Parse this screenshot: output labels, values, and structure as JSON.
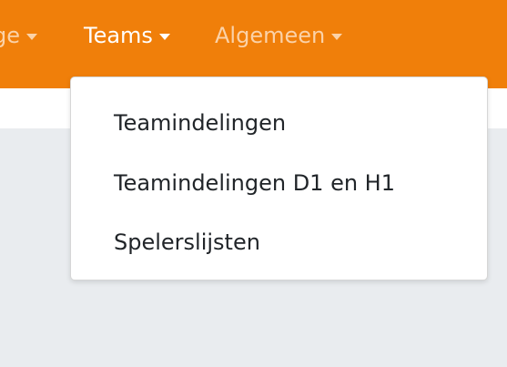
{
  "navbar": {
    "background_color": "#f07f0a",
    "items": [
      {
        "label": "ge",
        "state": "partially-visible",
        "icon": "caret-down-icon"
      },
      {
        "label": "Teams",
        "state": "open",
        "icon": "caret-down-icon"
      },
      {
        "label": "Algemeen",
        "icon": "caret-down-icon"
      }
    ]
  },
  "dropdown": {
    "items": [
      {
        "label": "Teamindelingen"
      },
      {
        "label": "Teamindelingen D1 en H1"
      },
      {
        "label": "Spelerslijsten"
      }
    ]
  },
  "colors": {
    "nav_active_text": "#ffffff",
    "nav_inactive_text": "#fbd2a8",
    "page_background": "#e9ecef",
    "menu_text": "#212529"
  }
}
